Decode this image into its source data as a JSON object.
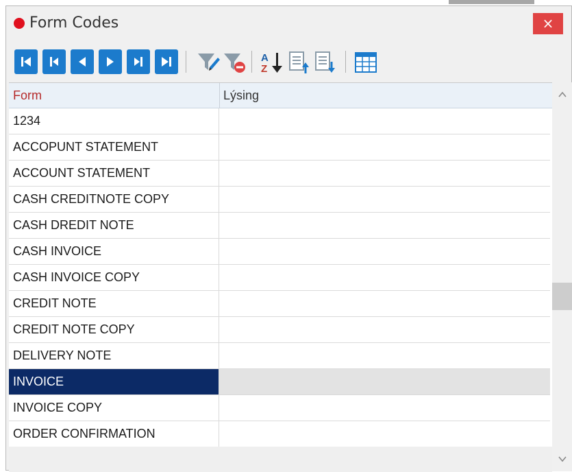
{
  "window": {
    "title": "Form Codes",
    "close_label": "×"
  },
  "toolbar": {
    "buttons": [
      "first-record",
      "prev-page",
      "prev-record",
      "next-record",
      "next-page",
      "last-record"
    ],
    "tools": [
      "filter-edit-icon",
      "filter-clear-icon",
      "sort-az-icon",
      "export-up-icon",
      "export-down-icon",
      "grid-view-icon"
    ]
  },
  "grid": {
    "headers": [
      "Form",
      "Lýsing"
    ],
    "rows": [
      "1234",
      "ACCOPUNT STATEMENT",
      "ACCOUNT STATEMENT",
      "CASH CREDITNOTE COPY",
      "CASH DREDIT NOTE",
      "CASH INVOICE",
      "CASH INVOICE COPY",
      "CREDIT NOTE",
      "CREDIT NOTE COPY",
      "DELIVERY NOTE",
      "INVOICE",
      "INVOICE COPY",
      "ORDER CONFIRMATION"
    ],
    "selected_row": "INVOICE"
  },
  "colors": {
    "accent": "#1c7bcc",
    "selection": "#0c2a66",
    "close": "#e04343",
    "header_form": "#b52a2a"
  }
}
